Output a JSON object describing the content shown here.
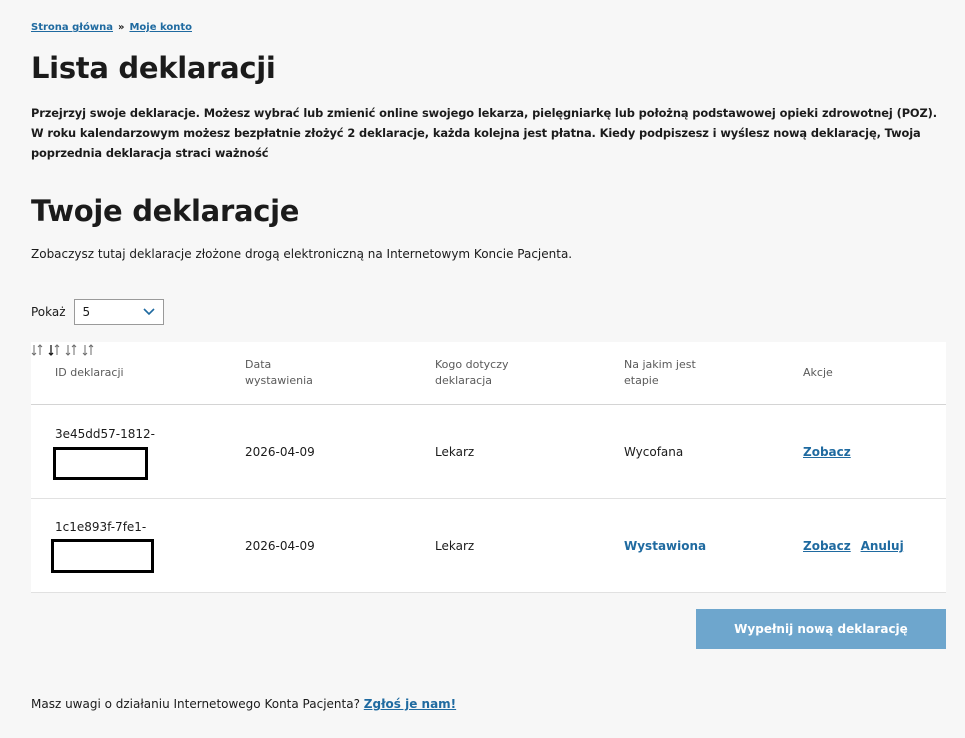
{
  "breadcrumb": {
    "home": "Strona główna",
    "separator": "»",
    "current": "Moje konto"
  },
  "page_title": "Lista deklaracji",
  "intro_text": "Przejrzyj swoje deklaracje. Możesz wybrać lub zmienić online swojego lekarza, pielęgniarkę lub położną podstawowej opieki zdrowotnej (POZ). W roku kalendarzowym możesz bezpłatnie złożyć 2 deklaracje, każda kolejna jest płatna. Kiedy podpiszesz i wyślesz nową deklarację, Twoja poprzednia deklaracja straci ważność",
  "section_title": "Twoje deklaracje",
  "section_intro": "Zobaczysz tutaj deklaracje złożone drogą elektroniczną na Internetowym Koncie Pacjenta.",
  "page_size": {
    "label": "Pokaż",
    "value": "5"
  },
  "table": {
    "headers": {
      "id": "ID deklaracji",
      "date": "Data wystawienia",
      "who": "Kogo dotyczy deklaracja",
      "stage": "Na jakim jest etapie",
      "actions": "Akcje"
    },
    "rows": [
      {
        "id": "3e45dd57-1812-",
        "date": "2026-04-09",
        "who": "Lekarz",
        "stage": "Wycofana",
        "view": "Zobacz"
      },
      {
        "id": "1c1e893f-7fe1-",
        "date": "2026-04-09",
        "who": "Lekarz",
        "stage": "Wystawiona",
        "view": "Zobacz",
        "cancel": "Anuluj"
      }
    ]
  },
  "new_declaration_button": "Wypełnij nową deklarację",
  "feedback": {
    "text": "Masz uwagi o działaniu Internetowego Konta Pacjenta?",
    "link": "Zgłoś je nam!"
  },
  "colors": {
    "link": "#1f6aa0",
    "button": "#6ea6cd",
    "background": "#f7f7f7"
  },
  "icons": {
    "sort": "sort-arrows-icon",
    "select": "chevron-down-icon"
  }
}
